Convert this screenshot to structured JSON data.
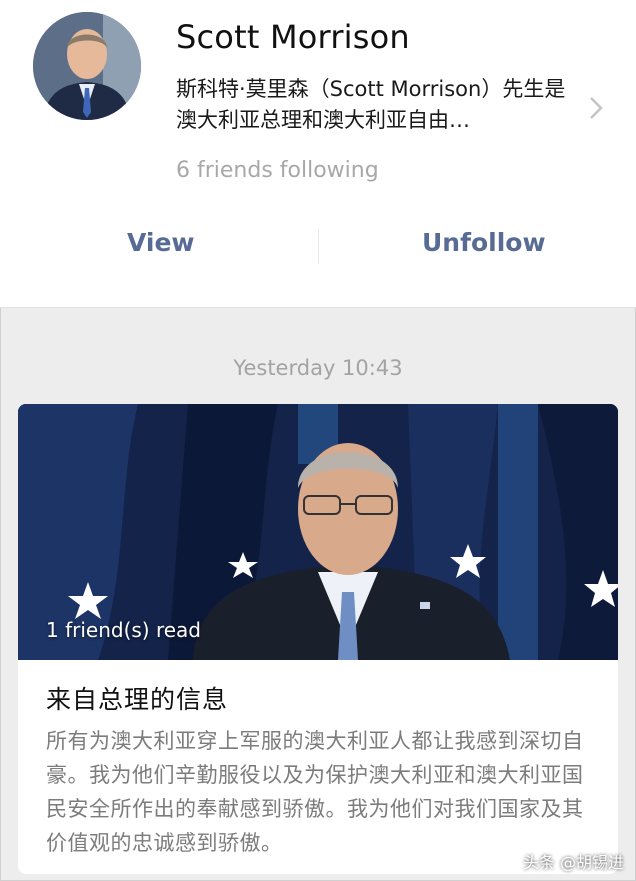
{
  "profile": {
    "name": "Scott Morrison",
    "bio": "斯科特·莫里森（Scott Morrison）先生是澳大利亚总理和澳大利亚自由…",
    "friends_following": "6 friends following",
    "view_label": "View",
    "unfollow_label": "Unfollow",
    "icons": {
      "chevron": "chevron-right-icon",
      "avatar": "profile-photo"
    }
  },
  "feed": {
    "timestamp": "Yesterday 10:43",
    "article": {
      "read_count": "1 friend(s) read",
      "title": "来自总理的信息",
      "excerpt": "所有为澳大利亚穿上军服的澳大利亚人都让我感到深切自豪。我为他们辛勤服役以及为保护澳大利亚和澳大利亚国民安全所作出的奉献感到骄傲。我为他们对我们国家及其价值观的忠诚感到骄傲。"
    }
  },
  "watermark": "头条 @胡锡进",
  "colors": {
    "link": "#576b95",
    "secondary_text": "#a8a8a8",
    "background": "#ededed",
    "card": "#ffffff"
  }
}
